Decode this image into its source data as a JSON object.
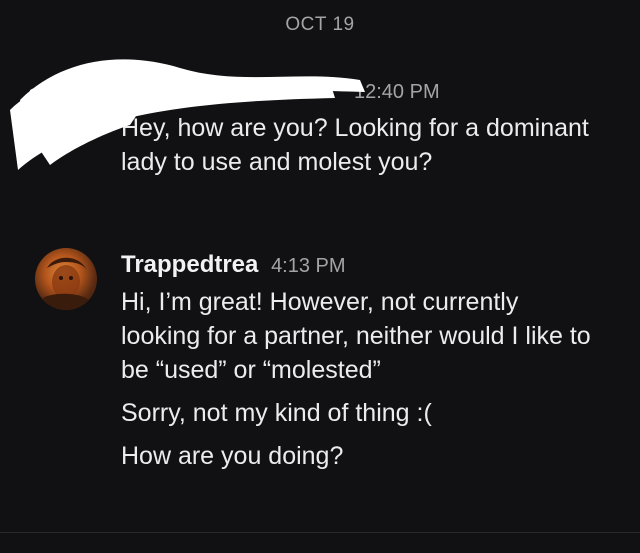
{
  "conversation": {
    "date_divider": "OCT 19",
    "messages": [
      {
        "author": "",
        "time": "12:40 PM",
        "paragraphs": [
          "Hey, how are you? Looking for a dominant lady to use and molest you?"
        ]
      },
      {
        "author": "Trappedtrea",
        "time": "4:13 PM",
        "avatar_icon": "profile-photo",
        "paragraphs": [
          "Hi, I’m great! However, not currently looking for a partner, neither would I like to be “used” or “molested”",
          "Sorry, not my kind of thing :(",
          "How are you doing?"
        ]
      }
    ]
  },
  "colors": {
    "background": "#111114",
    "text": "#ececee",
    "muted": "#a3a3a8",
    "redaction": "#ffffff"
  }
}
